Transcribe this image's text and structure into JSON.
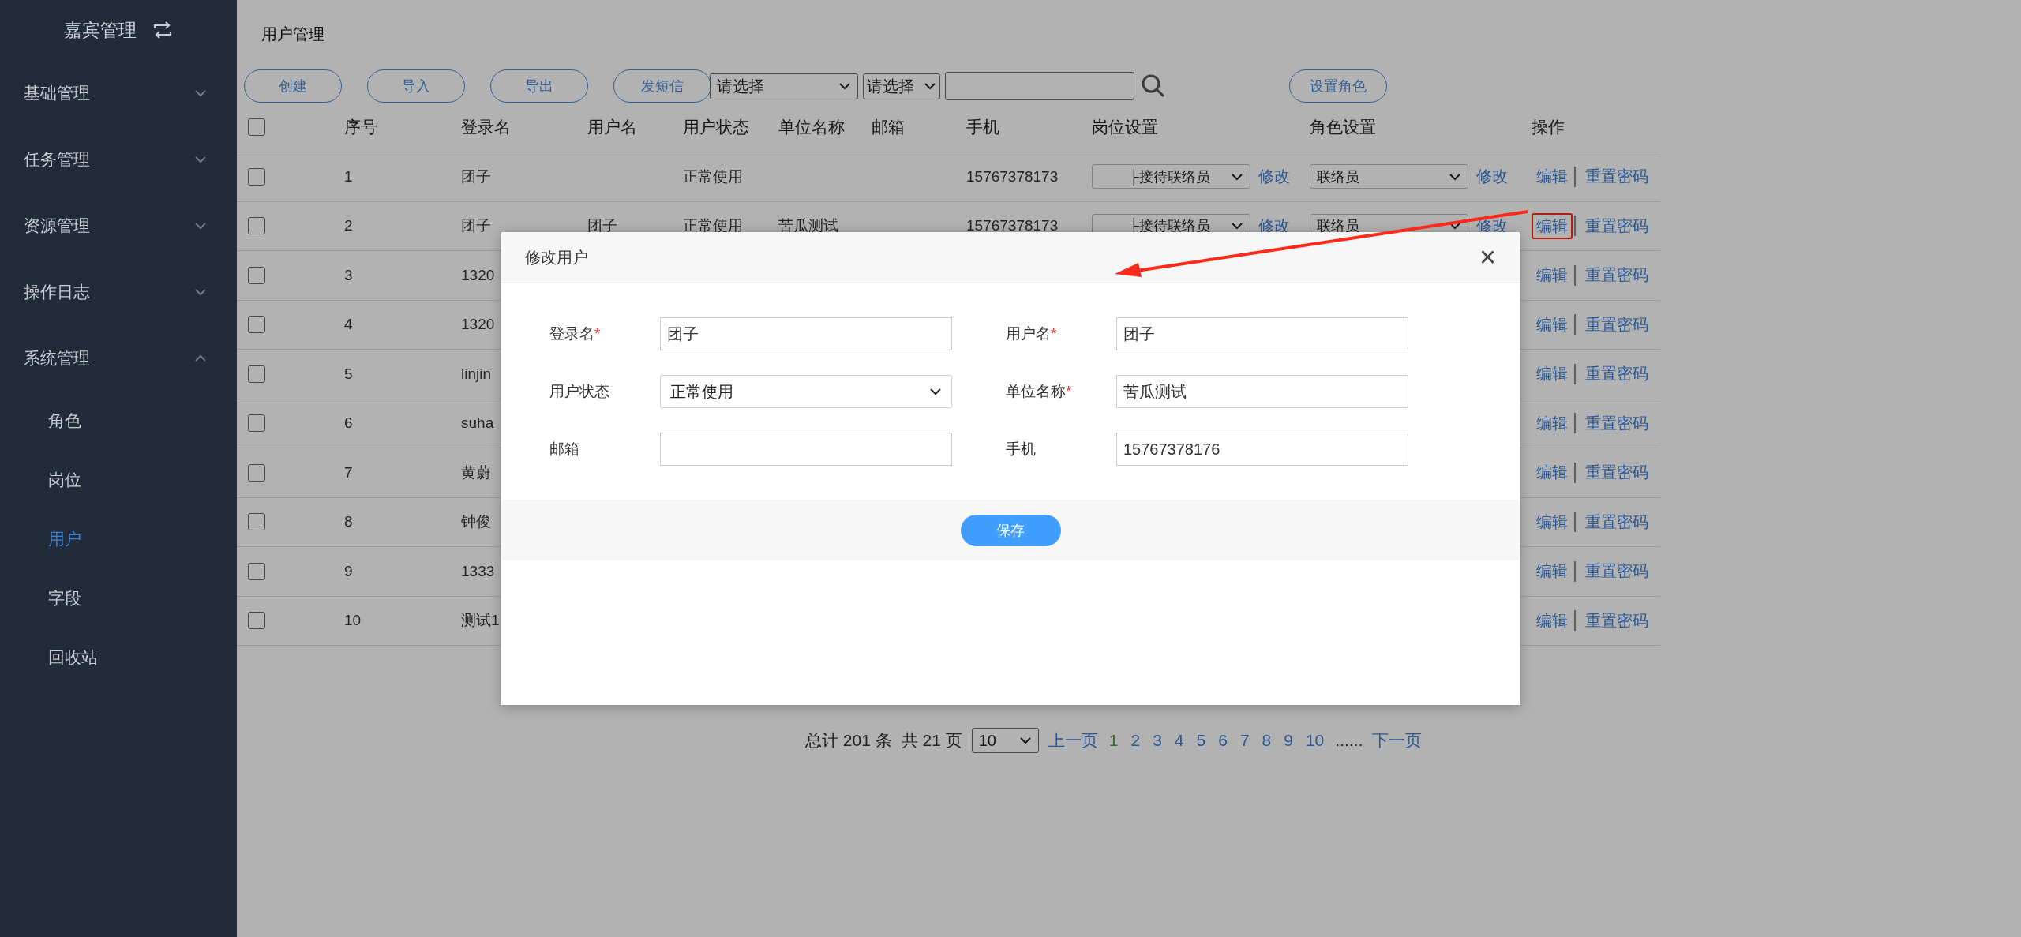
{
  "sidebar": {
    "title": "嘉宾管理",
    "items": [
      {
        "label": "基础管理",
        "expanded": false
      },
      {
        "label": "任务管理",
        "expanded": false
      },
      {
        "label": "资源管理",
        "expanded": false
      },
      {
        "label": "操作日志",
        "expanded": false
      },
      {
        "label": "系统管理",
        "expanded": true,
        "children": [
          {
            "label": "角色",
            "selected": false
          },
          {
            "label": "岗位",
            "selected": false
          },
          {
            "label": "用户",
            "selected": true
          },
          {
            "label": "字段",
            "selected": false
          },
          {
            "label": "回收站",
            "selected": false
          }
        ]
      }
    ]
  },
  "page_title": "用户管理",
  "toolbar": {
    "buttons": [
      "创建",
      "导入",
      "导出",
      "发短信"
    ],
    "selects": [
      "请选择",
      "请选择"
    ],
    "role_button": "设置角色"
  },
  "table": {
    "header_checked": false,
    "columns": [
      "序号",
      "登录名",
      "用户名",
      "用户状态",
      "单位名称",
      "邮箱",
      "手机",
      "岗位设置",
      "角色设置",
      "操作"
    ],
    "rows": [
      {
        "checked": false,
        "index": "1",
        "login_name": "团子",
        "status": "正常使用",
        "phone": "15767378173",
        "post": {
          "value": "├接待联络员",
          "link": "修改"
        },
        "role": {
          "value": "联络员",
          "link": "修改"
        },
        "actions": [
          "编辑",
          "重置密码"
        ],
        "highlighted": false
      },
      {
        "checked": false,
        "index": "2",
        "login_name": "团子",
        "user_name": "团子",
        "status": "正常使用",
        "org": "苦瓜测试",
        "phone": "15767378173",
        "post": {
          "value": "├接待联络员",
          "link": "修改"
        },
        "role": {
          "value": "联络员",
          "link": "修改"
        },
        "actions": [
          "编辑",
          "重置密码"
        ],
        "highlighted": true
      },
      {
        "checked": false,
        "index": "3",
        "login_name": "1320",
        "actions": [
          "编辑",
          "重置密码"
        ],
        "highlighted": false
      },
      {
        "checked": false,
        "index": "4",
        "login_name": "1320",
        "actions": [
          "编辑",
          "重置密码"
        ],
        "highlighted": false
      },
      {
        "checked": false,
        "index": "5",
        "login_name": "linjin",
        "actions": [
          "编辑",
          "重置密码"
        ],
        "highlighted": false
      },
      {
        "checked": false,
        "index": "6",
        "login_name": "suha",
        "actions": [
          "编辑",
          "重置密码"
        ],
        "highlighted": false
      },
      {
        "checked": false,
        "index": "7",
        "login_name": "黄蔚",
        "actions": [
          "编辑",
          "重置密码"
        ],
        "highlighted": false
      },
      {
        "checked": false,
        "index": "8",
        "login_name": "钟俊",
        "actions": [
          "编辑",
          "重置密码"
        ],
        "highlighted": false
      },
      {
        "checked": false,
        "index": "9",
        "login_name": "1333",
        "actions": [
          "编辑",
          "重置密码"
        ],
        "highlighted": false
      },
      {
        "checked": false,
        "index": "10",
        "login_name": "测试1",
        "actions": [
          "编辑",
          "重置密码"
        ],
        "highlighted": false
      }
    ]
  },
  "pagination": {
    "total": "总计 201 条",
    "pages": "共 21 页",
    "page_size": "10",
    "prev": "上一页",
    "page_links": [
      {
        "label": "1",
        "selected": true
      },
      {
        "label": "2",
        "selected": false
      },
      {
        "label": "3",
        "selected": false
      },
      {
        "label": "4",
        "selected": false
      },
      {
        "label": "5",
        "selected": false
      },
      {
        "label": "6",
        "selected": false
      },
      {
        "label": "7",
        "selected": false
      },
      {
        "label": "8",
        "selected": false
      },
      {
        "label": "9",
        "selected": false
      },
      {
        "label": "10",
        "selected": false
      }
    ],
    "ellipsis": "......",
    "next": "下一页"
  },
  "dialog": {
    "title": "修改用户",
    "close": "×",
    "fields": [
      {
        "kind": "text",
        "label": "登录名",
        "mark": "*",
        "value": "团子"
      },
      {
        "kind": "text",
        "label": "用户名",
        "mark": "*",
        "value": "团子"
      },
      {
        "kind": "select",
        "label": "用户状态",
        "value": "正常使用"
      },
      {
        "kind": "text",
        "label": "单位名称",
        "mark": "*",
        "value": "苦瓜测试"
      },
      {
        "kind": "text",
        "label": "邮箱"
      },
      {
        "kind": "text",
        "label": "手机",
        "value": "15767378176"
      }
    ],
    "save": "保存"
  }
}
